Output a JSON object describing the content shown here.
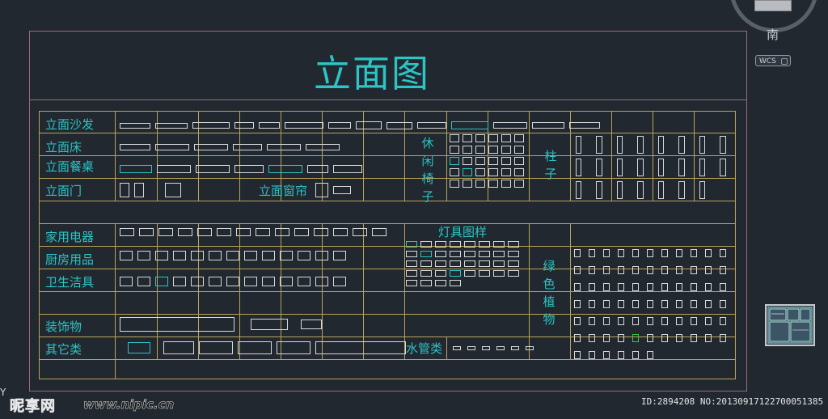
{
  "drawing": {
    "title": "立面图",
    "categories": {
      "sofa": "立面沙发",
      "bed": "立面床",
      "dining": "立面餐桌",
      "door": "立面门",
      "window": "立面窗帘",
      "leisure_chair": "休闲椅子",
      "column": "柱子",
      "appliance": "家用电器",
      "lamps": "灯具图样",
      "kitchen": "厨房用品",
      "green_plants": "绿色植物",
      "bathroom": "卫生洁具",
      "decoration": "装饰物",
      "others": "其它类",
      "water_pipe": "水管类"
    }
  },
  "viewcube": {
    "compass_label": "南",
    "ucs_label": "WCS"
  },
  "watermark": {
    "logo": "昵享网",
    "url": "www.nipic.cn",
    "id_text": "ID:2894208 NO:20130917122700051385"
  },
  "colors": {
    "background": "#212830",
    "grid_line": "#b9a45a",
    "label": "#2cc4c4",
    "title_frame": "#9a6a7a",
    "symbol": "#d9d9d9"
  }
}
